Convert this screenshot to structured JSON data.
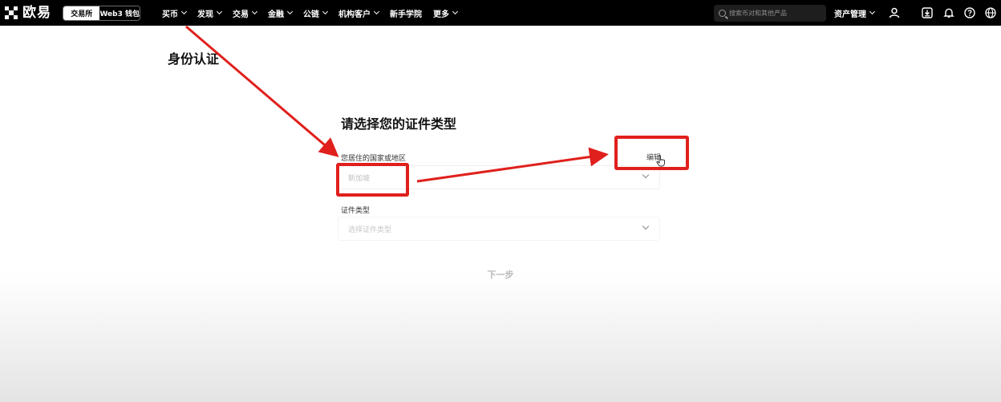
{
  "brand": {
    "name": "欧易",
    "logo_icon": "okx-logo-icon"
  },
  "mode_switch": {
    "exchange_label": "交易所",
    "wallet_label": "Web3 钱包",
    "active": "exchange"
  },
  "nav": {
    "items": [
      {
        "label": "买币"
      },
      {
        "label": "发现"
      },
      {
        "label": "交易"
      },
      {
        "label": "金融"
      },
      {
        "label": "公链"
      },
      {
        "label": "机构客户"
      },
      {
        "label": "新手学院",
        "has_dropdown": false
      },
      {
        "label": "更多"
      }
    ]
  },
  "search": {
    "placeholder": "搜索币对和其他产品",
    "icon": "search-icon"
  },
  "account": {
    "assets_label": "资产管理",
    "icons": [
      "user-icon",
      "download-icon",
      "bell-icon",
      "help-icon",
      "globe-icon"
    ]
  },
  "page": {
    "section_title": "身份认证",
    "form_heading": "请选择您的证件类型",
    "country_label": "您居住的国家或地区",
    "edit_label": "编辑",
    "country_value": "新加坡",
    "id_type_label": "证件类型",
    "id_type_placeholder": "选择证件类型",
    "next_button": "下一步"
  },
  "colors": {
    "topbar": "#000000",
    "annotation": "#e0201c",
    "disabled_text": "#b9b9b9"
  }
}
